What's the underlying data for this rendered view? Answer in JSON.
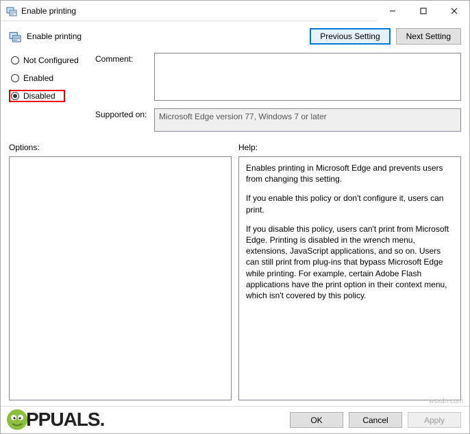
{
  "window": {
    "title": "Enable printing",
    "minimize": "—",
    "maximize": "☐",
    "close": "✕"
  },
  "header": {
    "title": "Enable printing",
    "previous_setting": "Previous Setting",
    "next_setting": "Next Setting"
  },
  "radios": {
    "not_configured": "Not Configured",
    "enabled": "Enabled",
    "disabled": "Disabled",
    "selected": "disabled"
  },
  "fields": {
    "comment_label": "Comment:",
    "comment_value": "",
    "supported_label": "Supported on:",
    "supported_value": "Microsoft Edge version 77, Windows 7 or later"
  },
  "options": {
    "label": "Options:",
    "body": ""
  },
  "help": {
    "label": "Help:",
    "p1": "Enables printing in Microsoft Edge and prevents users from changing this setting.",
    "p2": "If you enable this policy or don't configure it, users can print.",
    "p3": "If you disable this policy, users can't print from Microsoft Edge. Printing is disabled in the wrench menu, extensions, JavaScript applications, and so on. Users can still print from plug-ins that bypass Microsoft Edge while printing. For example, certain Adobe Flash applications have the print option in their context menu, which isn't covered by this policy."
  },
  "buttons": {
    "ok": "OK",
    "cancel": "Cancel",
    "apply": "Apply"
  },
  "watermark": "wsxdn.com",
  "logo": {
    "rest": "PPUALS."
  }
}
